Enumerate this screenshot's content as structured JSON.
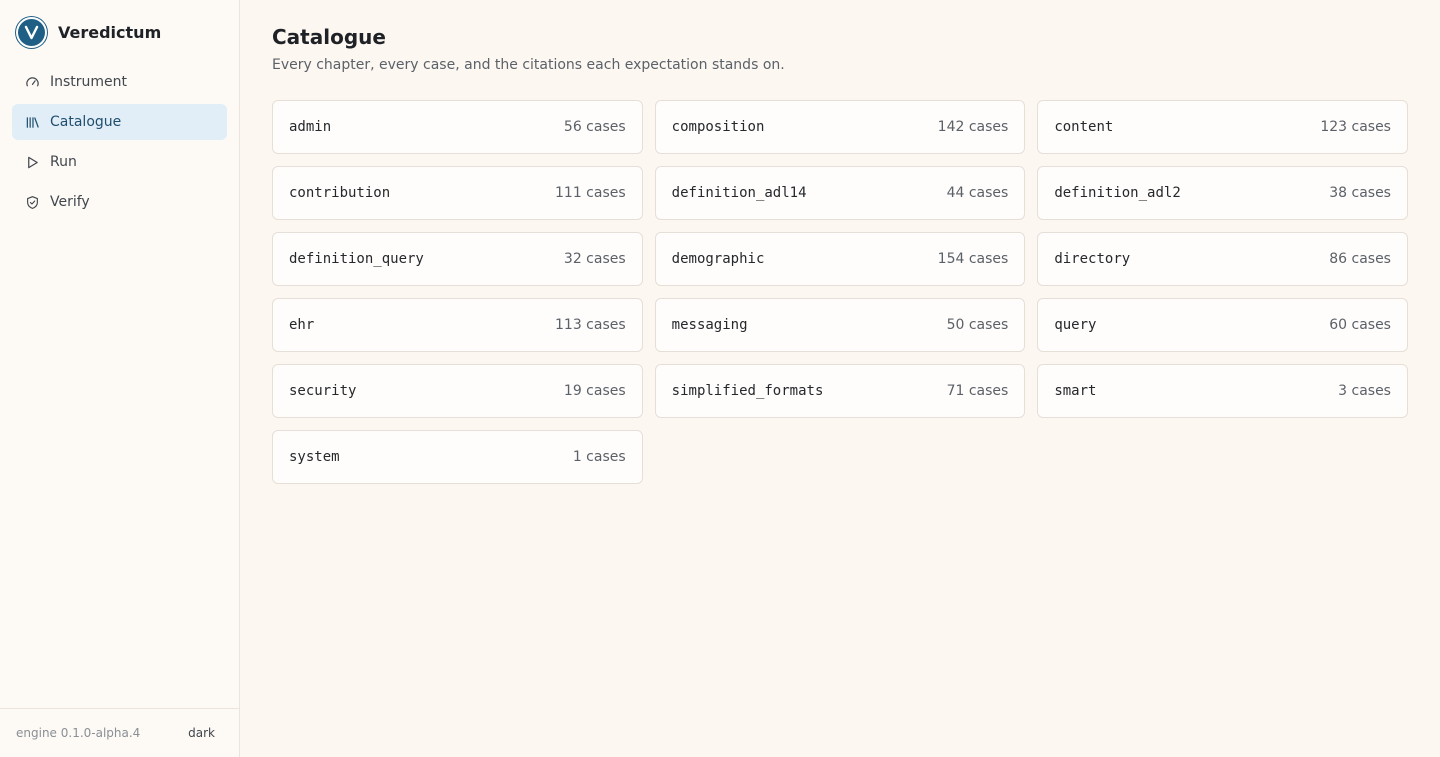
{
  "app": {
    "name": "Veredictum"
  },
  "nav": {
    "items": [
      {
        "label": "Instrument",
        "icon": "gauge-icon"
      },
      {
        "label": "Catalogue",
        "icon": "library-icon",
        "active": true
      },
      {
        "label": "Run",
        "icon": "play-icon"
      },
      {
        "label": "Verify",
        "icon": "shield-check-icon"
      }
    ]
  },
  "footer": {
    "engine": "engine 0.1.0-alpha.4",
    "theme": "dark"
  },
  "main": {
    "title": "Catalogue",
    "subtitle": "Every chapter, every case, and the citations each expectation stands on."
  },
  "chapters": [
    {
      "name": "admin",
      "count": "56 cases"
    },
    {
      "name": "composition",
      "count": "142 cases"
    },
    {
      "name": "content",
      "count": "123 cases"
    },
    {
      "name": "contribution",
      "count": "111 cases"
    },
    {
      "name": "definition_adl14",
      "count": "44 cases"
    },
    {
      "name": "definition_adl2",
      "count": "38 cases"
    },
    {
      "name": "definition_query",
      "count": "32 cases"
    },
    {
      "name": "demographic",
      "count": "154 cases"
    },
    {
      "name": "directory",
      "count": "86 cases"
    },
    {
      "name": "ehr",
      "count": "113 cases"
    },
    {
      "name": "messaging",
      "count": "50 cases"
    },
    {
      "name": "query",
      "count": "60 cases"
    },
    {
      "name": "security",
      "count": "19 cases"
    },
    {
      "name": "simplified_formats",
      "count": "71 cases"
    },
    {
      "name": "smart",
      "count": "3 cases"
    },
    {
      "name": "system",
      "count": "1 cases"
    }
  ],
  "colors": {
    "accent": "#1f5f86",
    "active_nav_bg": "#e2eef7",
    "background": "#fdf7f2"
  }
}
